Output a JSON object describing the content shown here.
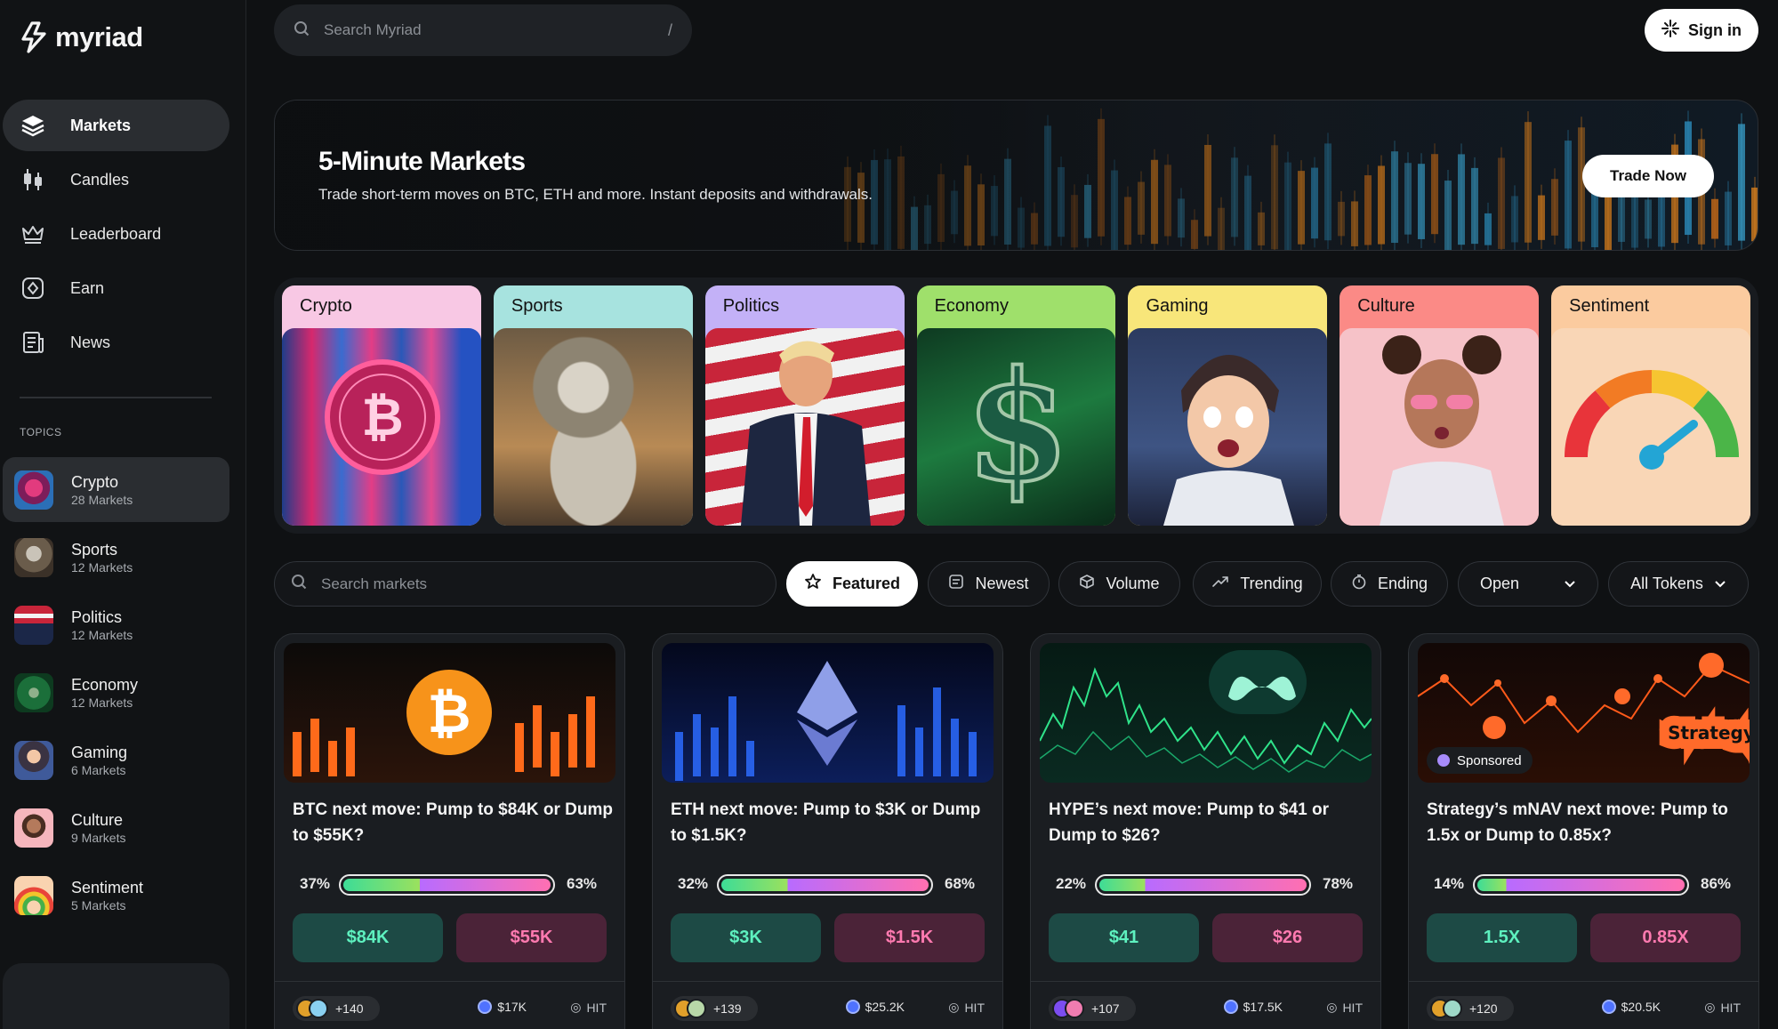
{
  "app": {
    "name": "myriad"
  },
  "header": {
    "search_placeholder": "Search Myriad",
    "search_shortcut": "/",
    "sign_in": "Sign in"
  },
  "nav": [
    {
      "label": "Markets",
      "icon": "layers-icon"
    },
    {
      "label": "Candles",
      "icon": "candles-icon"
    },
    {
      "label": "Leaderboard",
      "icon": "crown-icon"
    },
    {
      "label": "Earn",
      "icon": "earn-icon"
    },
    {
      "label": "News",
      "icon": "news-icon"
    }
  ],
  "topics_heading": "TOPICS",
  "topics": [
    {
      "name": "Crypto",
      "count": "28 Markets",
      "color": "#d1306b"
    },
    {
      "name": "Sports",
      "count": "12 Markets",
      "color": "#8a7b63"
    },
    {
      "name": "Politics",
      "count": "12 Markets",
      "color": "#b22a3b"
    },
    {
      "name": "Economy",
      "count": "12 Markets",
      "color": "#1d6b3a"
    },
    {
      "name": "Gaming",
      "count": "6 Markets",
      "color": "#4a5d8f"
    },
    {
      "name": "Culture",
      "count": "9 Markets",
      "color": "#f09aa6"
    },
    {
      "name": "Sentiment",
      "count": "5 Markets",
      "color": "#f7c89b"
    }
  ],
  "hero": {
    "title": "5-Minute Markets",
    "subtitle": "Trade short-term moves on BTC, ETH and more. Instant deposits and withdrawals.",
    "cta": "Trade Now"
  },
  "categories": [
    {
      "label": "Crypto",
      "color": "#f8c8e4"
    },
    {
      "label": "Sports",
      "color": "#a7e3df"
    },
    {
      "label": "Politics",
      "color": "#c3b1f7"
    },
    {
      "label": "Economy",
      "color": "#9fe06b"
    },
    {
      "label": "Gaming",
      "color": "#f8e67a"
    },
    {
      "label": "Culture",
      "color": "#fb8a86"
    },
    {
      "label": "Sentiment",
      "color": "#fbcb9f"
    }
  ],
  "filters": {
    "search_placeholder": "Search markets",
    "sorts": [
      {
        "label": "Featured",
        "icon": "star-icon"
      },
      {
        "label": "Newest",
        "icon": "newest-icon"
      },
      {
        "label": "Volume",
        "icon": "cube-icon"
      },
      {
        "label": "Trending",
        "icon": "trending-icon"
      },
      {
        "label": "Ending",
        "icon": "timer-icon"
      }
    ],
    "status": "Open",
    "tokens": "All Tokens"
  },
  "markets": [
    {
      "question": "BTC next move: Pump to $84K or Dump to $55K?",
      "yes_pct": "37%",
      "no_pct": "63%",
      "yes_ratio": 0.37,
      "yes": "$84K",
      "no": "$55K",
      "traders": "+140",
      "volume": "$17K",
      "token": "HIT",
      "sponsored": ""
    },
    {
      "question": "ETH next move: Pump to $3K or Dump to $1.5K?",
      "yes_pct": "32%",
      "no_pct": "68%",
      "yes_ratio": 0.32,
      "yes": "$3K",
      "no": "$1.5K",
      "traders": "+139",
      "volume": "$25.2K",
      "token": "HIT",
      "sponsored": ""
    },
    {
      "question": "HYPE’s next move: Pump to $41 or Dump to $26?",
      "yes_pct": "22%",
      "no_pct": "78%",
      "yes_ratio": 0.22,
      "yes": "$41",
      "no": "$26",
      "traders": "+107",
      "volume": "$17.5K",
      "token": "HIT",
      "sponsored": ""
    },
    {
      "question": "Strategy’s mNAV next move: Pump to 1.5x or Dump to 0.85x?",
      "yes_pct": "14%",
      "no_pct": "86%",
      "yes_ratio": 0.14,
      "yes": "1.5X",
      "no": "0.85X",
      "traders": "+120",
      "volume": "$20.5K",
      "token": "HIT",
      "sponsored": "Sponsored",
      "brand": "Strategy"
    }
  ]
}
